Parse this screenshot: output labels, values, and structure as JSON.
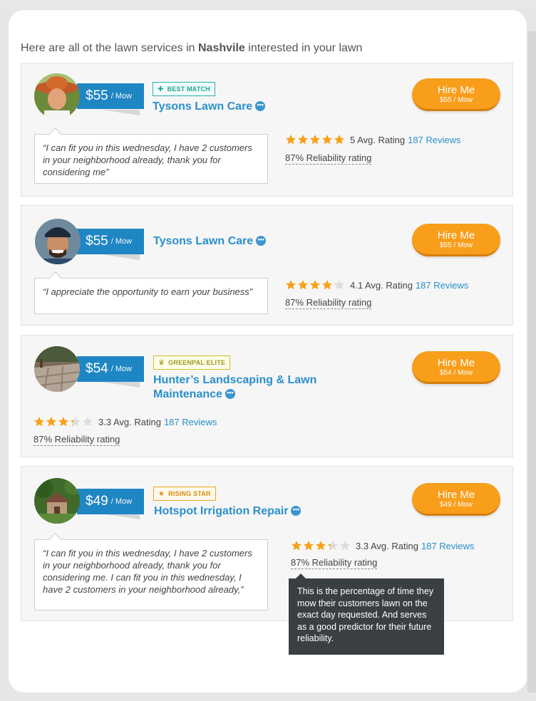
{
  "header": {
    "prefix": "Here are all ot the lawn services in ",
    "city": "Nashvile",
    "suffix": " interested in your lawn"
  },
  "colors": {
    "accent": "#1f86c4",
    "hire": "#f89e1b",
    "link": "#2b8fcb",
    "star": "#f7a11a",
    "star_empty": "#dddddd"
  },
  "cards": [
    {
      "avatar": "person-with-hat",
      "price": "$55",
      "price_unit": "/ Mow",
      "badge": "BEST MATCH",
      "badge_icon": "puzzle-icon",
      "name": "Tysons Lawn Care",
      "hire_label": "Hire Me",
      "hire_sub": "$55 / Mow",
      "quote": "“I can fit you in this wednesday, I have 2 customers in your neighborhood already, thank you for considering me”",
      "stars": 5,
      "rating_text": "5 Avg. Rating",
      "reviews": "187 Reviews",
      "reliability": "87% Reliability rating"
    },
    {
      "avatar": "person-smiling",
      "price": "$55",
      "price_unit": "/ Mow",
      "name": "Tysons Lawn Care",
      "hire_label": "Hire Me",
      "hire_sub": "$55 / Mow",
      "quote": "“I appreciate the opportunity to earn your business”",
      "stars": 4.1,
      "rating_text": "4.1 Avg. Rating",
      "reviews": "187 Reviews",
      "reliability": "87% Reliability rating"
    },
    {
      "avatar": "paved-patio",
      "price": "$54",
      "price_unit": "/ Mow",
      "badge": "GREENPAL ELITE",
      "badge_icon": "crown-icon",
      "name": "Hunter’s Landscaping & Lawn Maintenance",
      "hire_label": "Hire Me",
      "hire_sub": "$54 / Mow",
      "stars": 3.3,
      "rating_text": "3.3 Avg. Rating",
      "reviews": "187 Reviews",
      "reliability": "87% Reliability rating"
    },
    {
      "avatar": "house-with-trees",
      "price": "$49",
      "price_unit": "/ Mow",
      "badge": "RISING STAR",
      "badge_icon": "star-icon",
      "name": "Hotspot Irrigation Repair",
      "hire_label": "Hire Me",
      "hire_sub": "$49 / Mow",
      "quote": "“I can fit you in this wednesday, I have 2 customers in your neighborhood already, thank you for considering me. I can fit you in this wednesday, I have 2 customers in your neighborhood already,”",
      "stars": 3.3,
      "rating_text": "3.3 Avg. Rating",
      "reviews": "187 Reviews",
      "reliability": "87% Reliability rating"
    }
  ],
  "tooltip": "This is the percentage of time they mow their customers lawn on the exact day requested. And serves as a good predictor for their future reliability."
}
